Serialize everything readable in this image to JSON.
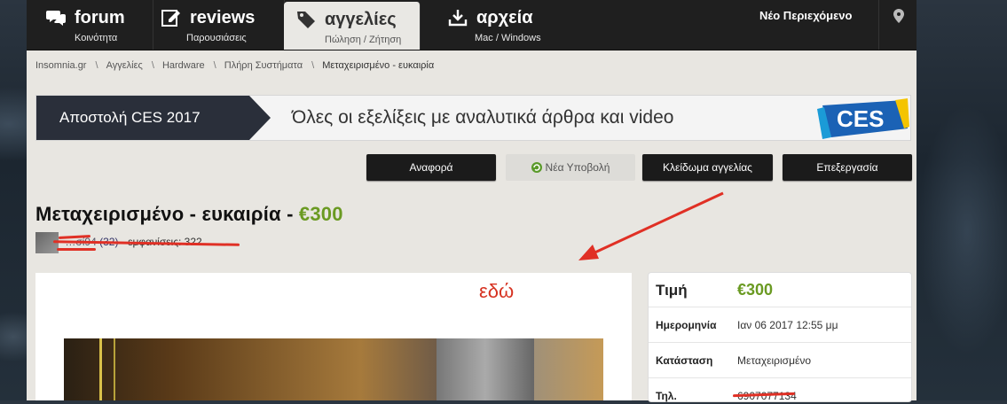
{
  "nav": {
    "tabs": [
      {
        "label": "forum",
        "sub": "Κοινότητα",
        "icon": "chat-icon"
      },
      {
        "label": "reviews",
        "sub": "Παρουσιάσεις",
        "icon": "edit-icon"
      },
      {
        "label": "αγγελίες",
        "sub": "Πώληση / Ζήτηση",
        "icon": "tag-icon",
        "active": true
      },
      {
        "label": "αρχεία",
        "sub": "Mac / Windows",
        "icon": "download-icon"
      }
    ],
    "new_content": "Νέο Περιεχόμενο",
    "location_icon": "location-pin-icon"
  },
  "breadcrumb": [
    "Insomnia.gr",
    "Αγγελίες",
    "Hardware",
    "Πλήρη Συστήματα"
  ],
  "breadcrumb_current": "Μεταχειρισμένο - ευκαιρία",
  "banner": {
    "left": "Αποστολή CES 2017",
    "text": "Όλες οι εξελίξεις με αναλυτικά άρθρα και video",
    "logo": "CES"
  },
  "actions": {
    "report": "Αναφορά",
    "new_submission": "Νέα Υποβολή",
    "lock": "Κλείδωμα αγγελίας",
    "edit": "Επεξεργασία"
  },
  "ad": {
    "title": "Μεταχειρισμένο - ευκαιρία - ",
    "price": "€300",
    "user": "…σί94",
    "user_count": "(32)",
    "views": "· εμφανίσεις: 322"
  },
  "annotation": "εδώ",
  "info": {
    "price_label": "Τιμή",
    "price_value": "€300",
    "date_label": "Ημερομηνία",
    "date_value": "Ιαν 06 2017 12:55 μμ",
    "condition_label": "Κατάσταση",
    "condition_value": "Μεταχειρισμένο",
    "phone_label": "Τηλ.",
    "phone_value": "6907077134"
  },
  "colors": {
    "price_green": "#6a9a22",
    "annot_red": "#e03025",
    "nav_bg": "#1f1f1f"
  }
}
